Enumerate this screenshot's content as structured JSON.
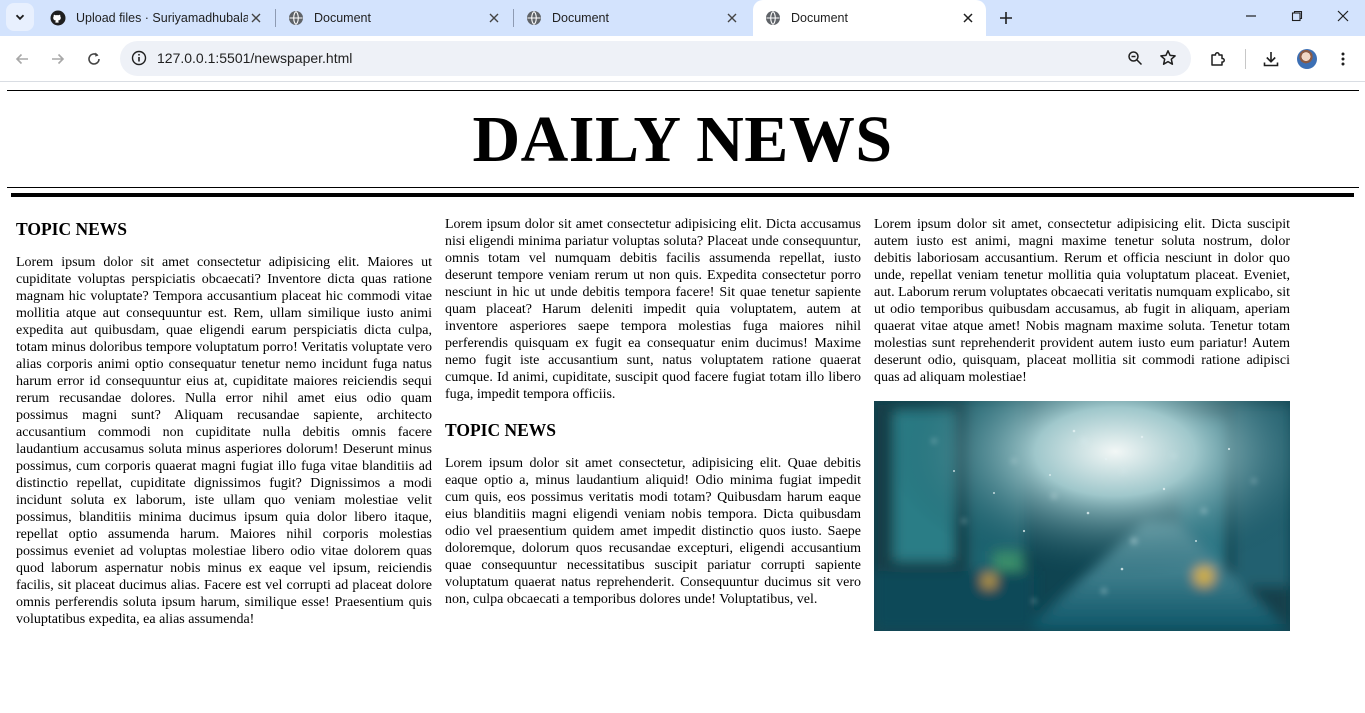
{
  "browser": {
    "tabs": [
      {
        "title": "Upload files · Suriyamadhubala",
        "favicon": "github-icon",
        "active": false
      },
      {
        "title": "Document",
        "favicon": "globe-icon",
        "active": false
      },
      {
        "title": "Document",
        "favicon": "globe-icon",
        "active": false
      },
      {
        "title": "Document",
        "favicon": "globe-icon",
        "active": true
      }
    ],
    "url": "127.0.0.1:5501/newspaper.html"
  },
  "newspaper": {
    "masthead": "DAILY NEWS",
    "column1": {
      "heading": "TOPIC NEWS",
      "body": "Lorem ipsum dolor sit amet consectetur adipisicing elit. Maiores ut cupiditate voluptas perspiciatis obcaecati? Inventore dicta quas ratione magnam hic voluptate? Tempora accusantium placeat hic commodi vitae mollitia atque aut consequuntur est. Rem, ullam similique iusto animi expedita aut quibusdam, quae eligendi earum perspiciatis dicta culpa, totam minus doloribus tempore voluptatum porro! Veritatis voluptate vero alias corporis animi optio consequatur tenetur nemo incidunt fuga natus harum error id consequuntur eius at, cupiditate maiores reiciendis sequi rerum recusandae dolores. Nulla error nihil amet eius odio quam possimus magni sunt? Aliquam recusandae sapiente, architecto accusantium commodi non cupiditate nulla debitis omnis facere laudantium accusamus soluta minus asperiores dolorum! Deserunt minus possimus, cum corporis quaerat magni fugiat illo fuga vitae blanditiis ad distinctio repellat, cupiditate dignissimos fugit? Dignissimos a modi incidunt soluta ex laborum, iste ullam quo veniam molestiae velit possimus, blanditiis minima ducimus ipsum quia dolor libero itaque, repellat optio assumenda harum. Maiores nihil corporis molestias possimus eveniet ad voluptas molestiae libero odio vitae dolorem quas quod laborum aspernatur nobis minus ex eaque vel ipsum, reiciendis facilis, sit placeat ducimus alias. Facere est vel corrupti ad placeat dolore omnis perferendis soluta ipsum harum, similique esse! Praesentium quis voluptatibus expedita, ea alias assumenda!"
    },
    "column2": {
      "intro": "Lorem ipsum dolor sit amet consectetur adipisicing elit. Dicta accusamus nisi eligendi minima pariatur voluptas soluta? Placeat unde consequuntur, omnis totam vel numquam debitis facilis assumenda repellat, iusto deserunt tempore veniam rerum ut non quis. Expedita consectetur porro nesciunt in hic ut unde debitis tempora facere! Sit quae tenetur sapiente quam placeat? Harum deleniti impedit quia voluptatem, autem at inventore asperiores saepe tempora molestias fuga maiores nihil perferendis quisquam ex fugit ea consequatur enim ducimus! Maxime nemo fugit iste accusantium sunt, natus voluptatem ratione quaerat cumque. Id animi, cupiditate, suscipit quod facere fugiat totam illo libero fuga, impedit tempora officiis.",
      "heading": "TOPIC NEWS",
      "body": "Lorem ipsum dolor sit amet consectetur, adipisicing elit. Quae debitis eaque optio a, minus laudantium aliquid! Odio minima fugiat impedit cum quis, eos possimus veritatis modi totam? Quibusdam harum eaque eius blanditiis magni eligendi veniam nobis tempora. Dicta quibusdam odio vel praesentium quidem amet impedit distinctio quos iusto. Saepe doloremque, dolorum quos recusandae excepturi, eligendi accusantium quae consequuntur necessitatibus suscipit pariatur corrupti sapiente voluptatum quaerat natus reprehenderit. Consequuntur ducimus sit vero non, culpa obcaecati a temporibus dolores unde! Voluptatibus, vel."
    },
    "column3": {
      "body": "Lorem ipsum dolor sit amet, consectetur adipisicing elit. Dicta suscipit autem iusto est animi, magni maxime tenetur soluta nostrum, dolor debitis laboriosam accusantium. Rerum et officia nesciunt in dolor quo unde, repellat veniam tenetur mollitia quia voluptatum placeat. Eveniet, aut. Laborum rerum voluptates obcaecati veritatis numquam explicabo, sit ut odio temporibus quibusdam accusamus, ab fugit in aliquam, aperiam quaerat vitae atque amet! Nobis magnam maxime soluta. Tenetur totam molestias sunt reprehenderit provident autem iusto eum pariatur! Autem deserunt odio, quisquam, placeat mollitia sit commodi ratione adipisci quas ad aliquam molestiae!"
    }
  }
}
